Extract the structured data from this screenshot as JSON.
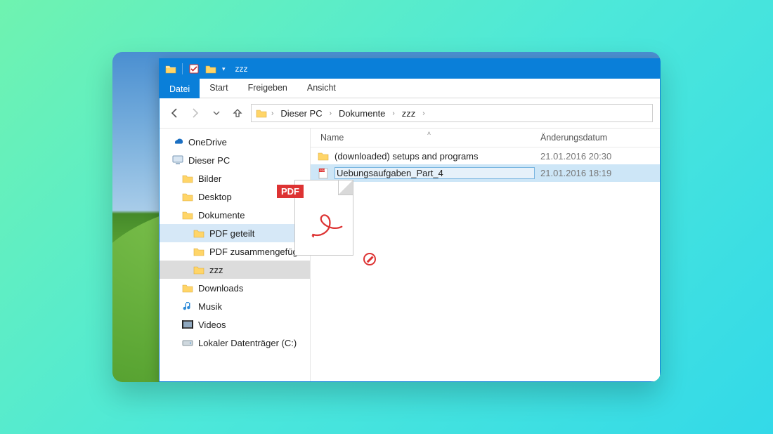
{
  "window": {
    "title": "zzz",
    "file_tab": "Datei",
    "tabs": [
      "Start",
      "Freigeben",
      "Ansicht"
    ]
  },
  "breadcrumb": [
    "Dieser PC",
    "Dokumente",
    "zzz"
  ],
  "columns": {
    "name": "Name",
    "modified": "Änderungsdatum"
  },
  "sidebar": {
    "items": [
      {
        "icon": "onedrive",
        "label": "OneDrive",
        "level": 0
      },
      {
        "icon": "pc",
        "label": "Dieser PC",
        "level": 0
      },
      {
        "icon": "folder",
        "label": "Bilder",
        "level": 1
      },
      {
        "icon": "folder",
        "label": "Desktop",
        "level": 1
      },
      {
        "icon": "folder",
        "label": "Dokumente",
        "level": 1
      },
      {
        "icon": "folder",
        "label": "PDF geteilt",
        "level": 2,
        "highlight": true
      },
      {
        "icon": "folder",
        "label": "PDF zusammengefügt",
        "level": 2
      },
      {
        "icon": "folder",
        "label": "zzz",
        "level": 2,
        "selected": true
      },
      {
        "icon": "folder",
        "label": "Downloads",
        "level": 1
      },
      {
        "icon": "music",
        "label": "Musik",
        "level": 1
      },
      {
        "icon": "video",
        "label": "Videos",
        "level": 1
      },
      {
        "icon": "drive",
        "label": "Lokaler Datenträger (C:)",
        "level": 1
      }
    ]
  },
  "files": [
    {
      "icon": "folder",
      "name": "(downloaded) setups and programs",
      "modified": "21.01.2016 20:30",
      "selected": false
    },
    {
      "icon": "pdf",
      "name": "Uebungsaufgaben_Part_4",
      "modified": "21.01.2016 18:19",
      "selected": true
    }
  ],
  "drag": {
    "badge": "PDF"
  }
}
